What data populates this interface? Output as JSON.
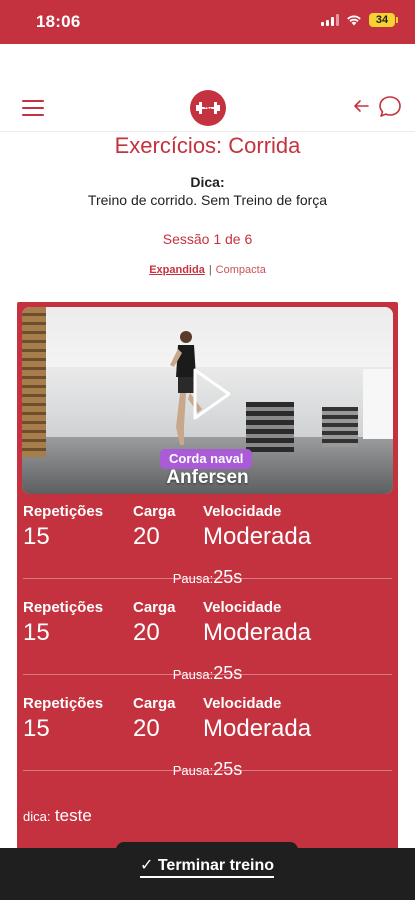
{
  "status_bar": {
    "time": "18:06",
    "battery": "34"
  },
  "header": {
    "menu_icon": "hamburger-menu-icon",
    "logo_icon": "dumbbell-logo-icon",
    "back_icon": "arrow-left-icon",
    "chat_icon": "chat-bubble-icon"
  },
  "page": {
    "title": "Exercícios: Corrida",
    "tip_label": "Dica:",
    "tip_text": "Treino de corrido. Sem Treino de força",
    "session": "Sessão 1 de 6",
    "view_expanded": "Expandida",
    "view_separator": "|",
    "view_compact": "Compacta"
  },
  "exercise": {
    "badge": "Corda naval",
    "name": "Anfersen",
    "sets": [
      {
        "rep_label": "Repetições",
        "reps": "15",
        "load_label": "Carga",
        "load": "20",
        "speed_label": "Velocidade",
        "speed": "Moderada",
        "pause_label": "Pausa:",
        "pause": "25s"
      },
      {
        "rep_label": "Repetições",
        "reps": "15",
        "load_label": "Carga",
        "load": "20",
        "speed_label": "Velocidade",
        "speed": "Moderada",
        "pause_label": "Pausa:",
        "pause": "25s"
      },
      {
        "rep_label": "Repetições",
        "reps": "15",
        "load_label": "Carga",
        "load": "20",
        "speed_label": "Velocidade",
        "speed": "Moderada",
        "pause_label": "Pausa:",
        "pause": "25s"
      }
    ],
    "tip_label": "dica:",
    "tip_value": "teste"
  },
  "footer": {
    "finish_label": "✓ Terminar treino"
  },
  "colors": {
    "accent": "#c5323f",
    "badge": "#a95cd6",
    "bottom_bar": "#1f1f1f",
    "battery": "#f6d233"
  }
}
